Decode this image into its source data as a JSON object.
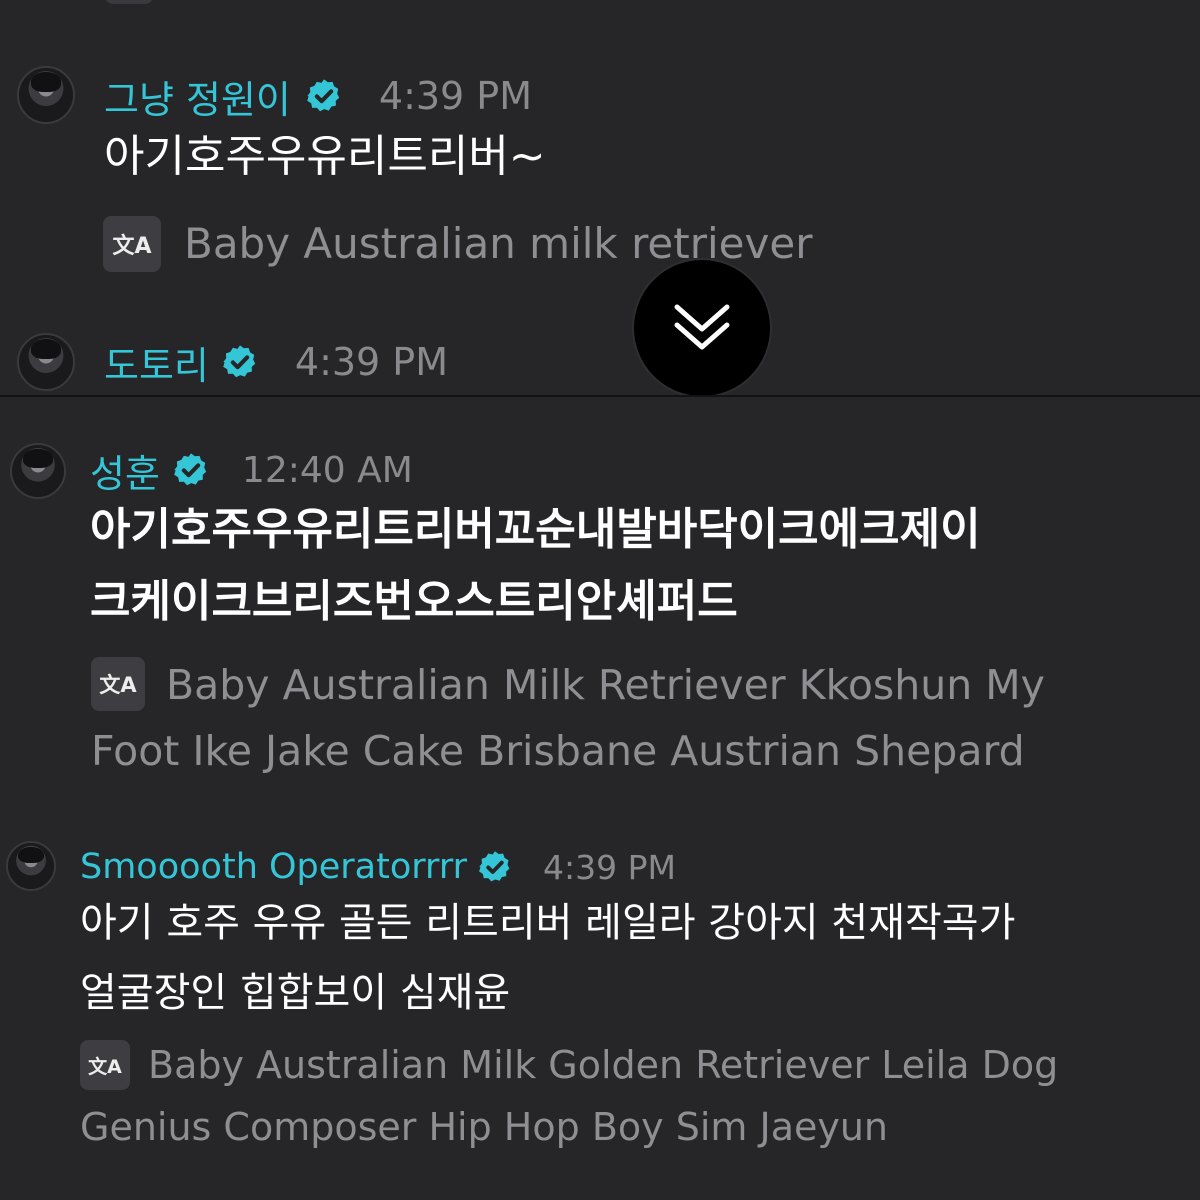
{
  "colors": {
    "background": "#262628",
    "username": "#34c6d6",
    "verified_badge": "#34c6d6",
    "timestamp": "#8a8a8e",
    "message": "#ffffff",
    "translation": "#8e8e93"
  },
  "messages_top": [
    {
      "username": "그냥 정원이",
      "time": "4:39 PM",
      "text": "아기호주우유리트리버~",
      "translation": "Baby Australian milk retriever",
      "verified_icon": "verified-check-icon",
      "translate_icon": "translate-icon"
    },
    {
      "username": "도토리",
      "time": "4:39 PM",
      "verified_icon": "verified-check-icon"
    }
  ],
  "scroll_button": {
    "icon": "double-chevron-down-icon"
  },
  "messages_bottom": [
    {
      "username": "성훈",
      "time": "12:40 AM",
      "text_lines": [
        "아기호주우유리트리버꼬순내발바닥이크에크제이",
        "크케이크브리즈번오스트리안셰퍼드"
      ],
      "translation_lines": [
        "Baby Australian Milk Retriever Kkoshun My",
        "Foot Ike Jake Cake Brisbane Austrian Shepard"
      ],
      "verified_icon": "verified-check-icon",
      "translate_icon": "translate-icon"
    },
    {
      "username": "Smooooth Operatorrrr",
      "time": "4:39 PM",
      "text_lines": [
        "아기 호주 우유 골든 리트리버 레일라 강아지 천재작곡가",
        "얼굴장인 힙합보이 심재윤"
      ],
      "translation_lines": [
        "Baby Australian Milk Golden Retriever Leila Dog",
        "Genius Composer Hip Hop Boy Sim Jaeyun"
      ],
      "verified_icon": "verified-check-icon",
      "translate_icon": "translate-icon"
    }
  ]
}
